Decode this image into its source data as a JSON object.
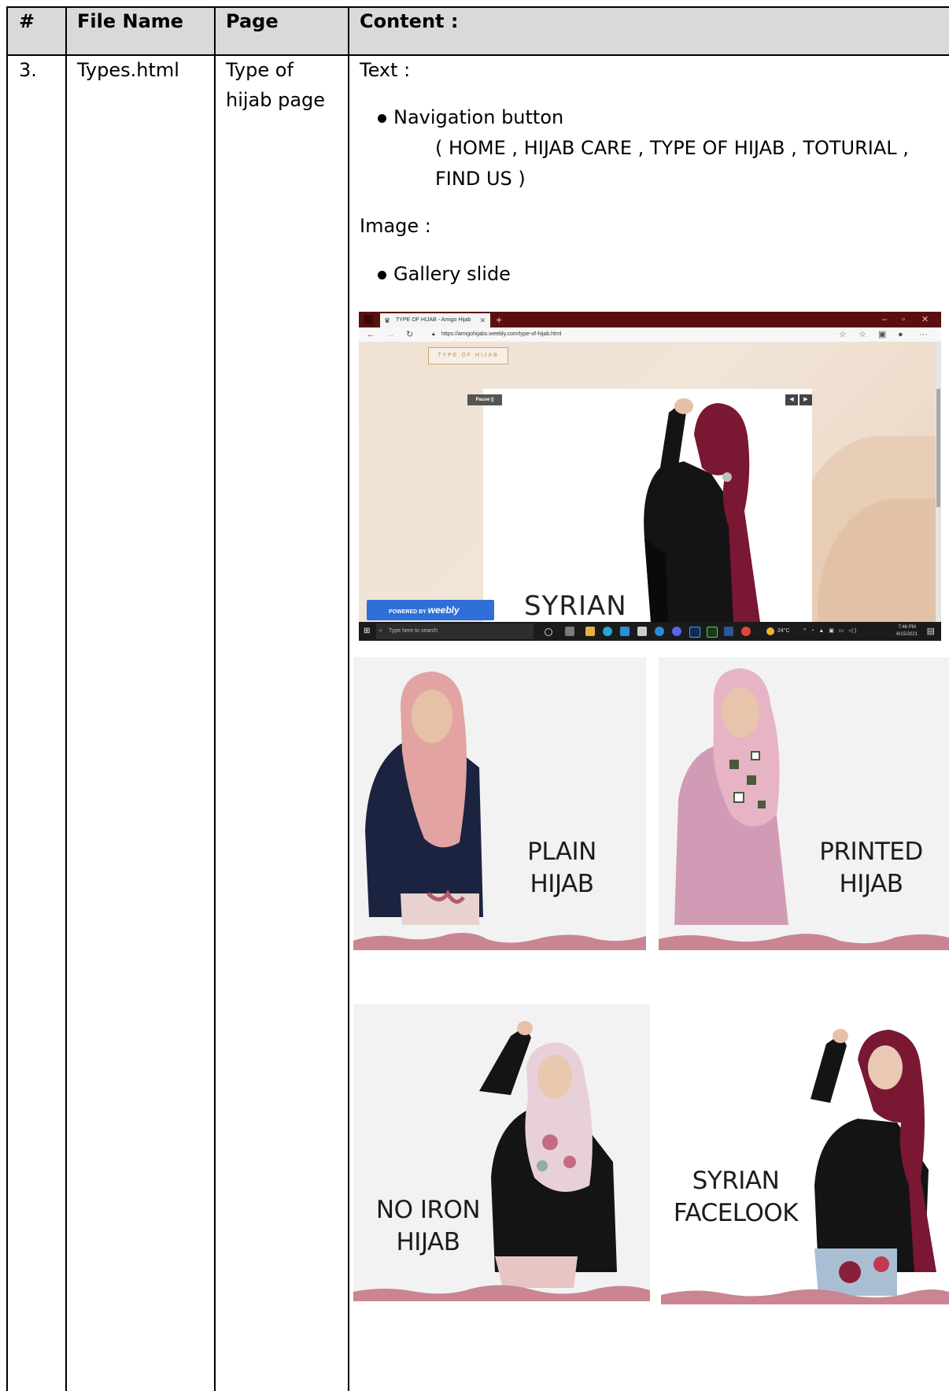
{
  "table": {
    "headers": {
      "number": "#",
      "file_name": "File Name",
      "page": "Page",
      "content": "Content :"
    },
    "row": {
      "number": "3.",
      "file_name": "Types.html",
      "page_line1": "Type of",
      "page_line2": "hijab page",
      "text_heading": "Text :",
      "text_bullet": "Navigation button",
      "nav_line1": "( HOME , HIJAB CARE , TYPE OF HIJAB , TOTURIAL ,",
      "nav_line2": "FIND US )",
      "image_heading": "Image :",
      "image_bullet": "Gallery slide"
    }
  },
  "screenshot": {
    "tab_title": "TYPE OF HIJAB - Amigo Hijab",
    "url": "https://amigohijabs.weebly.com/type-of-hijab.html",
    "site_nav": "TYPE OF HIJAB",
    "pause_button": "Pause ||",
    "slide_caption": "SYRIAN",
    "weebly_prefix": "POWERED BY",
    "weebly_brand": "weebly",
    "taskbar_search": "Type here to search",
    "temperature": "24°C",
    "time": "7:46 PM",
    "date": "6/15/2021"
  },
  "products": [
    {
      "line1": "PLAIN",
      "line2": "HIJAB"
    },
    {
      "line1": "PRINTED",
      "line2": "HIJAB"
    },
    {
      "line1": "NO IRON",
      "line2": "HIJAB"
    },
    {
      "line1": "SYRIAN",
      "line2": "FACELOOK"
    }
  ],
  "colors": {
    "header_bg": "#d9d9d9",
    "browser_titlebar": "#5b1010",
    "weebly_blue": "#2e6fd8",
    "plum": "#7a1733",
    "rose": "#e2a3a2",
    "navy": "#1b2340",
    "mauve": "#d29bb5"
  }
}
